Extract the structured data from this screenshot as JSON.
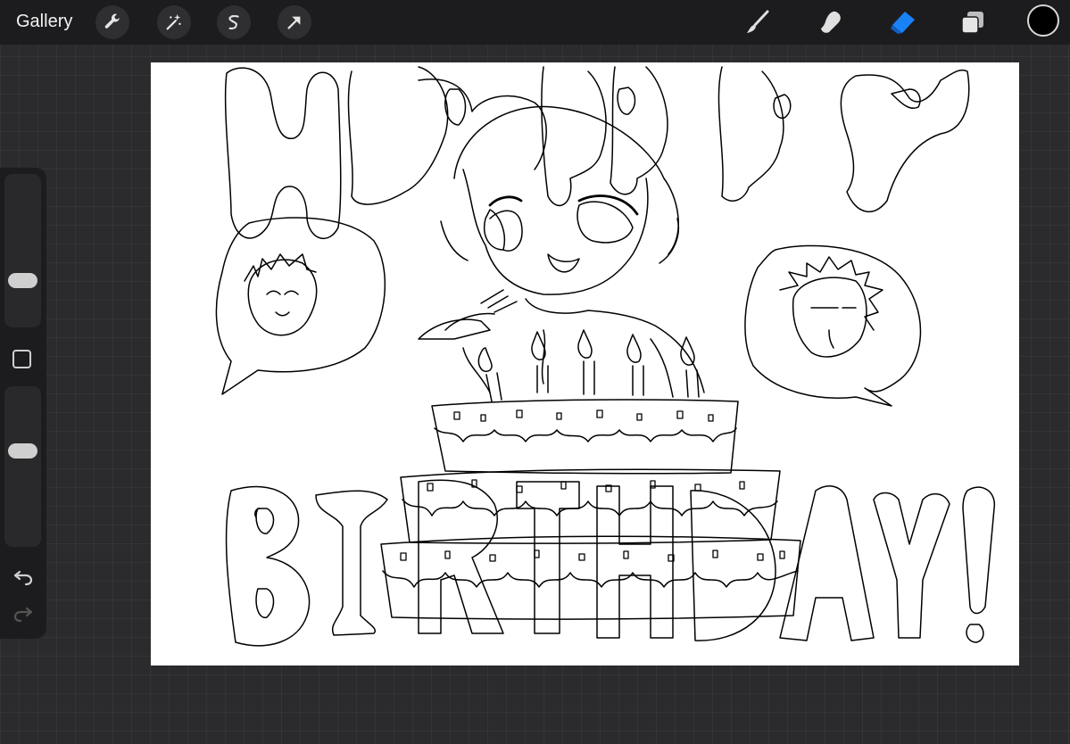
{
  "toolbar": {
    "gallery_label": "Gallery",
    "left_tools": [
      "wrench-icon",
      "magic-wand-icon",
      "selection-icon",
      "transform-arrow-icon"
    ],
    "right_tools": [
      "brush-icon",
      "smudge-icon",
      "eraser-icon",
      "layers-icon"
    ],
    "active_tool": "eraser-icon",
    "accent_color": "#1a82f7",
    "current_color": "#000000"
  },
  "sidebar": {
    "brush_size_level": 0.27,
    "opacity_level": 0.61,
    "modify_button": "square-icon",
    "undo": "undo-icon",
    "redo": "redo-icon"
  }
}
